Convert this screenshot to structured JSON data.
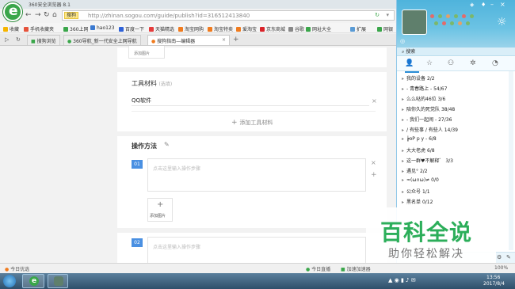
{
  "browser": {
    "window_title": "360安全浏览器 8.1",
    "address_badge": "搜狗",
    "url": "http://zhinan.sogou.com/guide/publish?id=316512413840",
    "bookmarks": [
      "收藏",
      "手机收藏夹",
      "360上网",
      "hao123",
      "百度一下",
      "天猫精选",
      "淘宝网购",
      "淘宝特卖",
      "爱淘宝",
      "京东商城",
      "谷歌",
      "网址大全"
    ],
    "bookmarks_right": [
      "扩展",
      "网银"
    ],
    "tabs": [
      "搜狗浏览",
      "360导航_新一代安全上网导航",
      "搜狗指南—编辑器"
    ],
    "status_left": "今日优选",
    "status_right": [
      "今日直播",
      "加速加速器"
    ],
    "zoom": "100%"
  },
  "editor": {
    "add_image_top": "添加图片",
    "tools_label": "工具材料",
    "tools_hint": "(选填)",
    "tools_value": "QQ软件",
    "add_tool": "添加工具材料",
    "steps_title": "操作方法",
    "steps": [
      {
        "num": "01",
        "placeholder": "点击这里输入操作步骤",
        "add_image": "添加图片"
      },
      {
        "num": "02",
        "placeholder": "点击这里输入操作步骤"
      }
    ]
  },
  "qq": {
    "search_label": "搜索",
    "groups": [
      {
        "name": "我的设备",
        "count": "2/2"
      },
      {
        "name": "- 青春路上 -",
        "count": "54/67"
      },
      {
        "name": "么么哒的46位",
        "count": "3/6"
      },
      {
        "name": "陪你久的死党队",
        "count": "38/48"
      },
      {
        "name": "- 我们一起闹 -",
        "count": "27/36"
      },
      {
        "name": "/ 有些事 / 有些人",
        "count": "14/39"
      },
      {
        "name": "┢oP p y -",
        "count": "6/8"
      },
      {
        "name": "大大老虎",
        "count": "6/8"
      },
      {
        "name": "这一群♥不解释゛",
        "count": "3/3"
      },
      {
        "name": "遇见°",
        "count": "2/2"
      },
      {
        "name": "≈(ω∩ω)≠",
        "count": "0/0"
      },
      {
        "name": "公众号",
        "count": "1/1"
      },
      {
        "name": "黑名单",
        "count": "0/12"
      }
    ]
  },
  "watermark": {
    "main": "百科全说",
    "sub": "助你轻松解决"
  },
  "taskbar": {
    "time": "13:56",
    "date": "2017/8/4"
  }
}
